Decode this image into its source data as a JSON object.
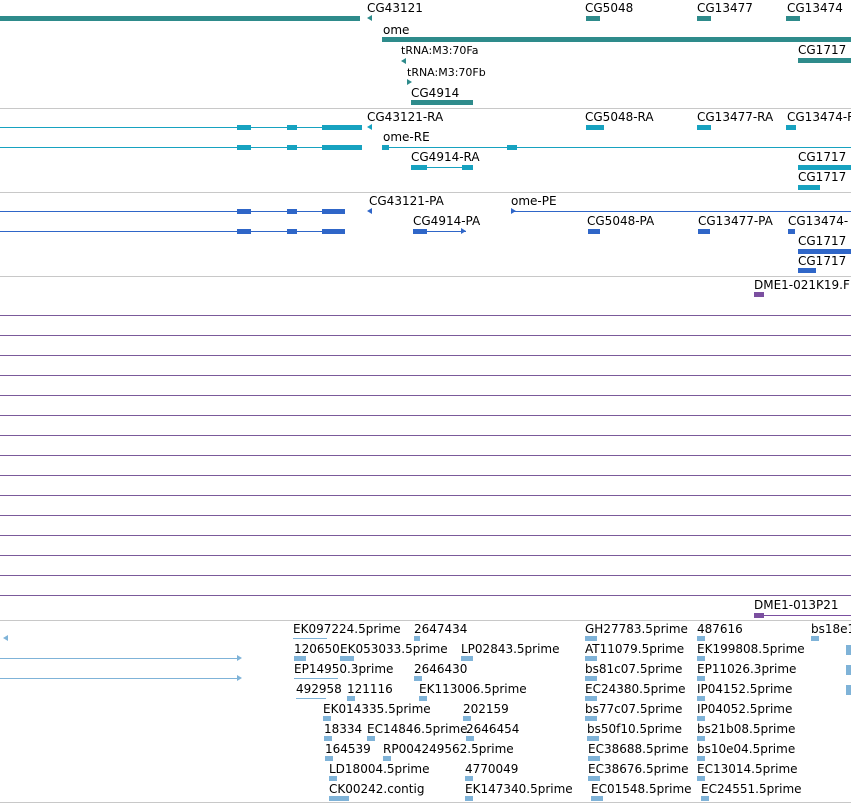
{
  "colors": {
    "gene": "#2e8b8b",
    "transcript": "#17a2c0",
    "protein": "#2f66c8",
    "clone": "#7b4fa0",
    "est": "#7fb3d8",
    "rule": "#c8c8c8"
  },
  "gene_track": {
    "labels": [
      "CG43121",
      "CG5048",
      "CG13477",
      "CG13474",
      "ome",
      "tRNA:M3:70Fa",
      "tRNA:M3:70Fb",
      "CG4914",
      "CG1717"
    ]
  },
  "transcript_track": {
    "labels": [
      "CG43121-RA",
      "CG5048-RA",
      "CG13477-RA",
      "CG13474-R",
      "ome-RE",
      "CG4914-RA",
      "CG1717",
      "CG1717"
    ]
  },
  "protein_track": {
    "labels": [
      "CG43121-PA",
      "ome-PE",
      "CG4914-PA",
      "CG5048-PA",
      "CG13477-PA",
      "CG13474-",
      "CG1717",
      "CG1717"
    ]
  },
  "clone_track": {
    "labels": [
      "DME1-021K19.F",
      "DME1-013P21"
    ]
  },
  "est_track": {
    "labels": [
      "EK097224.5prime",
      "2647434",
      "GH27783.5prime",
      "487616",
      "bs18e1",
      "120650",
      "EK053033.5prime",
      "LP02843.5prime",
      "AT11079.5prime",
      "EK199808.5prime",
      "EP14950.3prime",
      "2646430",
      "bs81c07.5prime",
      "EP11026.3prime",
      "492958",
      "121116",
      "EK113006.5prime",
      "EC24380.5prime",
      "IP04152.5prime",
      "EK014335.5prime",
      "202159",
      "bs77c07.5prime",
      "IP04052.5prime",
      "18334",
      "EC14846.5prime",
      "2646454",
      "bs50f10.5prime",
      "bs21b08.5prime",
      "164539",
      "RP004249562.5prime",
      "EC38688.5prime",
      "bs10e04.5prime",
      "LD18004.5prime",
      "4770049",
      "EC38676.5prime",
      "EC13014.5prime",
      "CK00242.contig",
      "EK147340.5prime",
      "EC01548.5prime",
      "EC24551.5prime"
    ]
  }
}
